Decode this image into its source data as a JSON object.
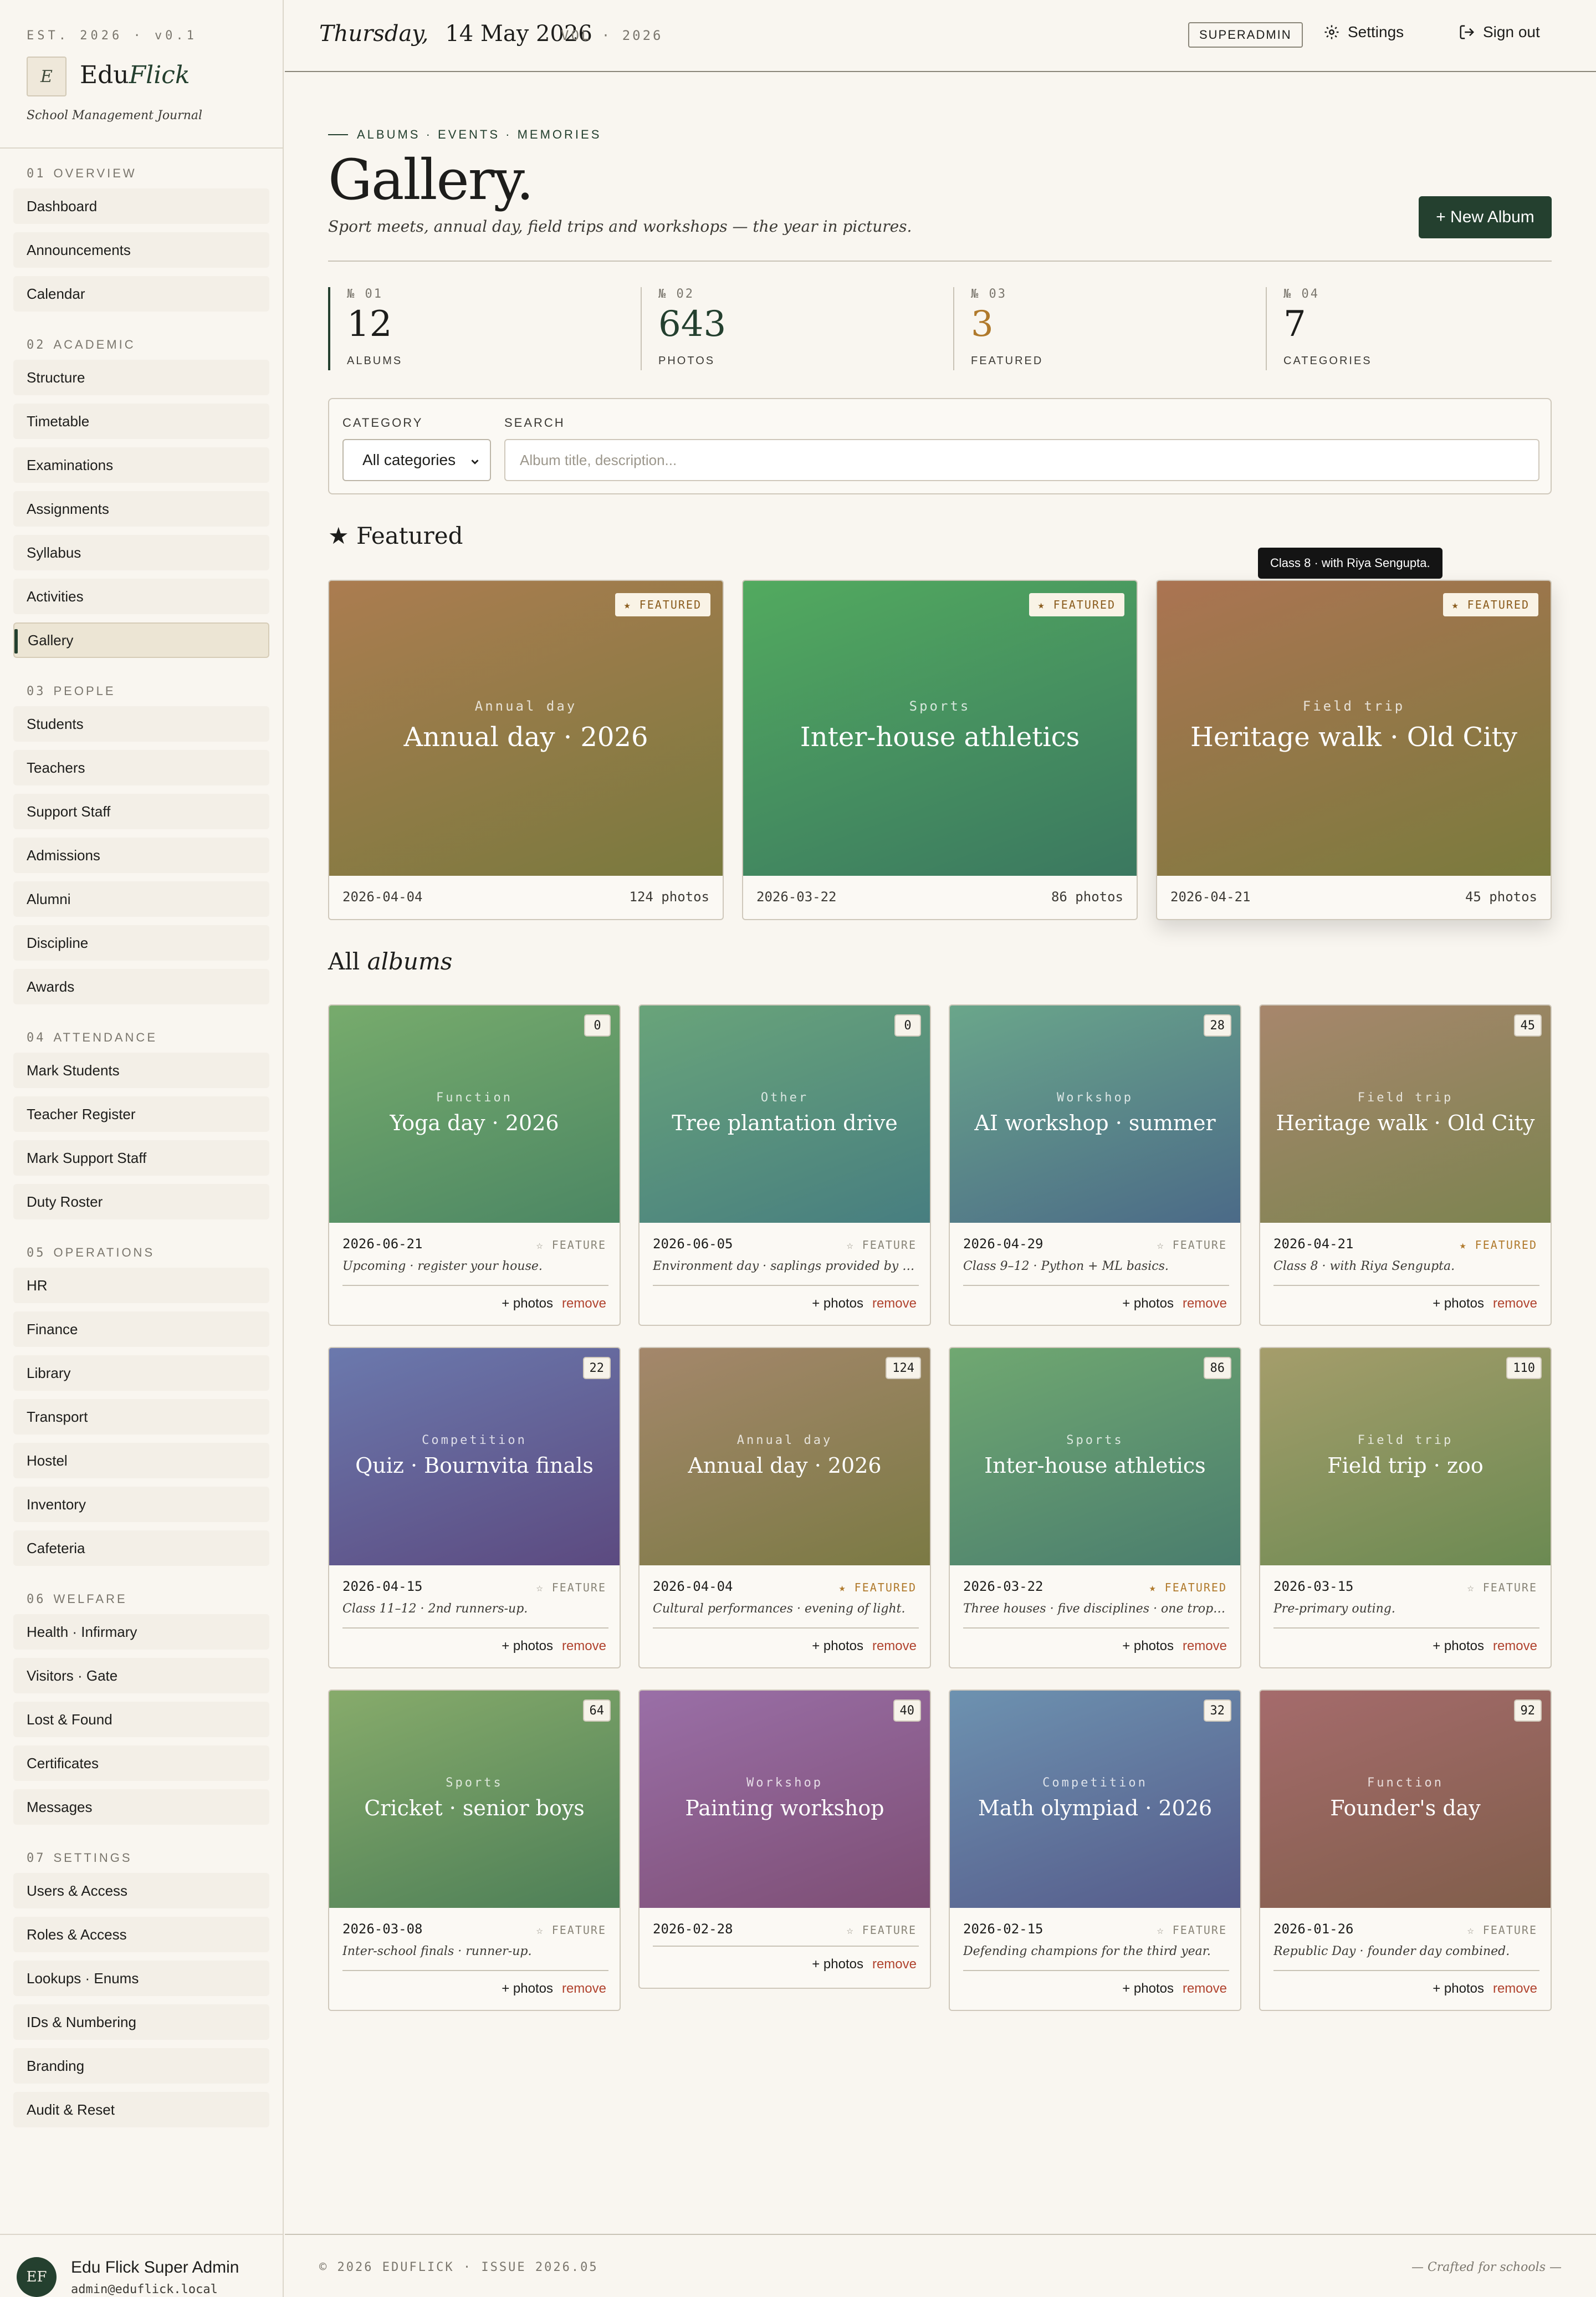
{
  "sidebar": {
    "est": "EST. 2026 · v0.1",
    "logo_letter": "E",
    "brand_a": "Edu",
    "brand_b": "Flick",
    "tagline": "School Management Journal",
    "sections": [
      {
        "num": "01",
        "title": "OVERVIEW",
        "items": [
          "Dashboard",
          "Announcements",
          "Calendar"
        ]
      },
      {
        "num": "02",
        "title": "ACADEMIC",
        "items": [
          "Structure",
          "Timetable",
          "Examinations",
          "Assignments",
          "Syllabus",
          "Activities",
          "Gallery"
        ]
      },
      {
        "num": "03",
        "title": "PEOPLE",
        "items": [
          "Students",
          "Teachers",
          "Support Staff",
          "Admissions",
          "Alumni",
          "Discipline",
          "Awards"
        ]
      },
      {
        "num": "04",
        "title": "ATTENDANCE",
        "items": [
          "Mark Students",
          "Teacher Register",
          "Mark Support Staff",
          "Duty Roster"
        ]
      },
      {
        "num": "05",
        "title": "OPERATIONS",
        "items": [
          "HR",
          "Finance",
          "Library",
          "Transport",
          "Hostel",
          "Inventory",
          "Cafeteria"
        ]
      },
      {
        "num": "06",
        "title": "WELFARE",
        "items": [
          "Health · Infirmary",
          "Visitors · Gate",
          "Lost & Found",
          "Certificates",
          "Messages"
        ]
      },
      {
        "num": "07",
        "title": "SETTINGS",
        "items": [
          "Users & Access",
          "Roles & Access",
          "Lookups · Enums",
          "IDs & Numbering",
          "Branding",
          "Audit & Reset"
        ]
      }
    ],
    "active_item": "Gallery",
    "user": {
      "initials": "EF",
      "name": "Edu Flick Super Admin",
      "email": "admin@eduflick.local"
    }
  },
  "topbar": {
    "weekday": "Thursday,",
    "date": "14 May 2026",
    "vol": "VOL · 2026",
    "role": "SUPERADMIN",
    "settings": "Settings",
    "signout": "Sign out"
  },
  "header": {
    "crumb": "ALBUMS · EVENTS · MEMORIES",
    "title": "Gallery.",
    "subtitle": "Sport meets, annual day, field trips and workshops — the year in pictures.",
    "new_button": "+ New Album"
  },
  "stats": [
    {
      "num": "№ 01",
      "value": "12",
      "label": "ALBUMS",
      "color": "#1d1d1b"
    },
    {
      "num": "№ 02",
      "value": "643",
      "label": "PHOTOS",
      "color": "#24402f"
    },
    {
      "num": "№ 03",
      "value": "3",
      "label": "FEATURED",
      "color": "#b07a2c"
    },
    {
      "num": "№ 04",
      "value": "7",
      "label": "CATEGORIES",
      "color": "#1d1d1b"
    }
  ],
  "filter": {
    "category_label": "CATEGORY",
    "category_value": "All categories",
    "search_label": "SEARCH",
    "search_placeholder": "Album title, description..."
  },
  "featured_heading": "★ Featured",
  "tooltip": "Class 8 · with Riya Sengupta.",
  "featured": [
    {
      "badge": "★ FEATURED",
      "category": "Annual day",
      "title": "Annual day · 2026",
      "date": "2026-04-04",
      "photos": "124 photos",
      "c1": "#ab7c50",
      "c2": "#797a3e"
    },
    {
      "badge": "★ FEATURED",
      "category": "Sports",
      "title": "Inter-house athletics",
      "date": "2026-03-22",
      "photos": "86 photos",
      "c1": "#52aa5f",
      "c2": "#3b7860"
    },
    {
      "badge": "★ FEATURED",
      "category": "Field trip",
      "title": "Heritage walk · Old City",
      "date": "2026-04-21",
      "photos": "45 photos",
      "c1": "#ab7452",
      "c2": "#7a7b3d"
    }
  ],
  "all_heading_a": "All",
  "all_heading_b": "albums",
  "albums": [
    {
      "count": "0",
      "category": "Function",
      "title": "Yoga day · 2026",
      "date": "2026-06-21",
      "feature": "☆ FEATURE",
      "featured": false,
      "desc": "Upcoming · register your house.",
      "c1": "#77ab6c",
      "c2": "#4c8764"
    },
    {
      "count": "0",
      "category": "Other",
      "title": "Tree plantation drive",
      "date": "2026-06-05",
      "feature": "☆ FEATURE",
      "featured": false,
      "desc": "Environment day · saplings provided by city ...",
      "c1": "#69a47a",
      "c2": "#477e80"
    },
    {
      "count": "28",
      "category": "Workshop",
      "title": "AI workshop · summer",
      "date": "2026-04-29",
      "feature": "☆ FEATURE",
      "featured": false,
      "desc": "Class 9–12 · Python + ML basics.",
      "c1": "#6aa68a",
      "c2": "#4b6a88"
    },
    {
      "count": "45",
      "category": "Field trip",
      "title": "Heritage walk · Old City",
      "date": "2026-04-21",
      "feature": "★ FEATURED",
      "featured": true,
      "desc": "Class 8 · with Riya Sengupta.",
      "c1": "#a7866c",
      "c2": "#7c8450"
    },
    {
      "count": "22",
      "category": "Competition",
      "title": "Quiz · Bournvita finals",
      "date": "2026-04-15",
      "feature": "☆ FEATURE",
      "featured": false,
      "desc": "Class 11–12 · 2nd runners-up.",
      "c1": "#6b79ad",
      "c2": "#5c4a80"
    },
    {
      "count": "124",
      "category": "Annual day",
      "title": "Annual day · 2026",
      "date": "2026-04-04",
      "feature": "★ FEATURED",
      "featured": true,
      "desc": "Cultural performances · evening of light.",
      "c1": "#a4876b",
      "c2": "#7b7a44"
    },
    {
      "count": "86",
      "category": "Sports",
      "title": "Inter-house athletics",
      "date": "2026-03-22",
      "feature": "★ FEATURED",
      "featured": true,
      "desc": "Three houses · five disciplines · one trophy.",
      "c1": "#70a871",
      "c2": "#4a7d6e"
    },
    {
      "count": "110",
      "category": "Field trip",
      "title": "Field trip · zoo",
      "date": "2026-03-15",
      "feature": "☆ FEATURE",
      "featured": false,
      "desc": "Pre-primary outing.",
      "c1": "#a59d6b",
      "c2": "#6b8a52"
    },
    {
      "count": "64",
      "category": "Sports",
      "title": "Cricket · senior boys",
      "date": "2026-03-08",
      "feature": "☆ FEATURE",
      "featured": false,
      "desc": "Inter-school finals · runner-up.",
      "c1": "#87ab6b",
      "c2": "#4d7f57"
    },
    {
      "count": "40",
      "category": "Workshop",
      "title": "Painting workshop",
      "date": "2026-02-28",
      "feature": "☆ FEATURE",
      "featured": false,
      "desc": "",
      "c1": "#9a6fa7",
      "c2": "#7d4e74"
    },
    {
      "count": "32",
      "category": "Competition",
      "title": "Math olympiad · 2026",
      "date": "2026-02-15",
      "feature": "☆ FEATURE",
      "featured": false,
      "desc": "Defending champions for the third year.",
      "c1": "#6d92b0",
      "c2": "#555a8a"
    },
    {
      "count": "92",
      "category": "Function",
      "title": "Founder's day",
      "date": "2026-01-26",
      "feature": "☆ FEATURE",
      "featured": false,
      "desc": "Republic Day · founder day combined.",
      "c1": "#a56b6c",
      "c2": "#805e4a"
    }
  ],
  "card_actions": {
    "add": "+ photos",
    "remove": "remove"
  },
  "footer": {
    "left": "© 2026 EDUFLICK · ISSUE 2026.05",
    "right": "— Crafted for schools —"
  }
}
